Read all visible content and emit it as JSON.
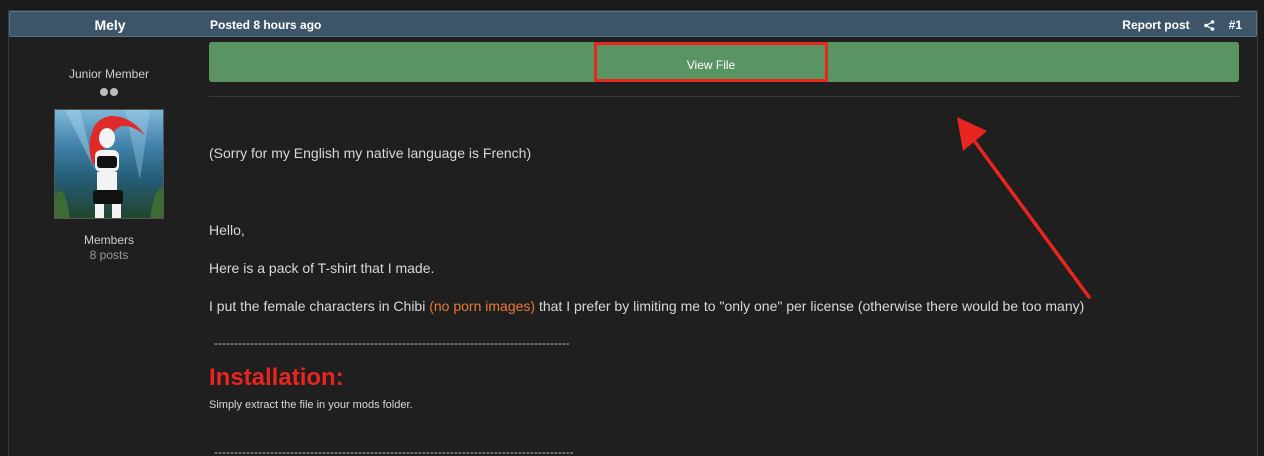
{
  "header": {
    "author": "Mely",
    "posted": "Posted 8 hours ago",
    "report": "Report post",
    "share_icon": "share-icon",
    "post_number": "#1"
  },
  "author_panel": {
    "rank": "Junior Member",
    "group": "Members",
    "posts": "8 posts"
  },
  "content": {
    "view_file": "View File",
    "sorry": "(Sorry for my English my native language is French)",
    "hello": "Hello,",
    "pack": "Here is a pack of T-shirt that I made.",
    "chibi_pre": "I put the female characters in Chibi ",
    "chibi_highlight": "(no porn images)",
    "chibi_post": " that I prefer by limiting me to \"only one\" per license (otherwise there would be too many)",
    "dashes1": "-----------------------------------------------------------------------------------------",
    "installation": "Installation:",
    "install_text": "Simply extract the file in your mods folder.",
    "dashes2": "------------------------------------------------------------------------------------------"
  },
  "colors": {
    "header_bg": "#3d5568",
    "view_file_bg": "#5a9463",
    "annotation_red": "#e8251f",
    "highlight_orange": "#e87a3a"
  }
}
